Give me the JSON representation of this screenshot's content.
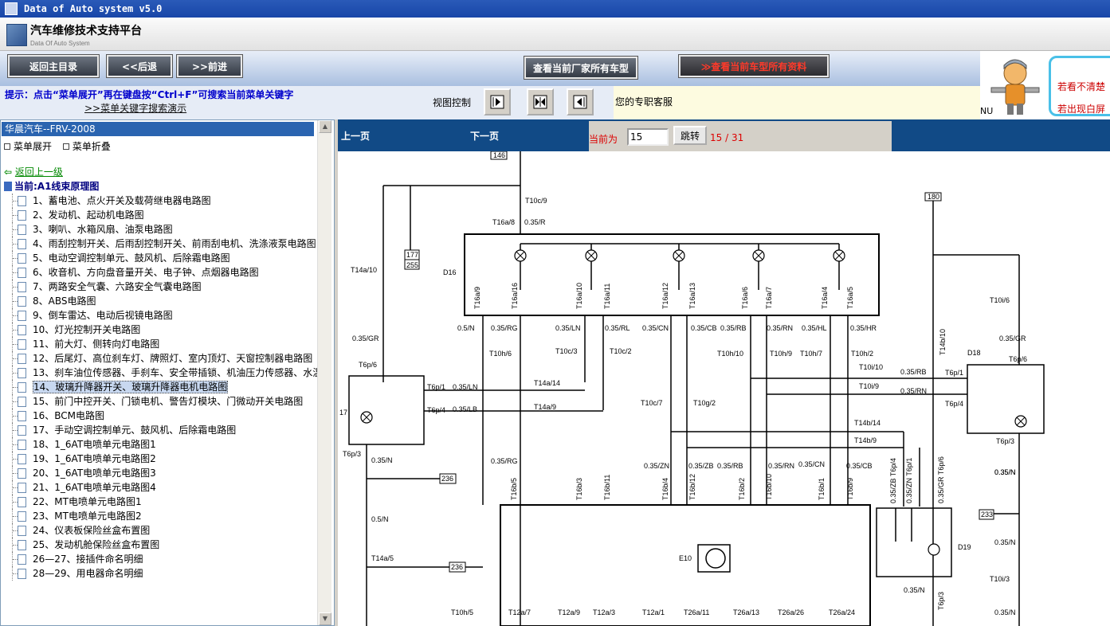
{
  "window": {
    "title": "Data of Auto system v5.0"
  },
  "header": {
    "brand": "汽车维修技术支持平台",
    "brand_sub": "Data Of Auto System"
  },
  "toolbar": {
    "home": "返回主目录",
    "back": "<<后退",
    "forward": ">>前进",
    "all_models": "查看当前厂家所有车型",
    "all_data": "查看当前车型所有资料",
    "all_data_prefix": "≫"
  },
  "hint": {
    "text": "提示：点击“菜单展开”再在键盘按“Ctrl+F”可搜索当前菜单关键字",
    "demo_link": ">>菜单关键字搜索演示",
    "view_control": "视图控制",
    "customer_service": "您的专职客服"
  },
  "banner": {
    "left_text": "NU",
    "line1": "若看不清楚",
    "line2": "若出现白屏"
  },
  "left_panel": {
    "title": "华晨汽车--FRV-2008",
    "expand": "菜单展开",
    "collapse": "菜单折叠",
    "back_link": "返回上一级",
    "current": "当前:A1线束原理图",
    "items": [
      "1、蓄电池、点火开关及载荷继电器电路图",
      "2、发动机、起动机电路图",
      "3、喇叭、水箱风扇、油泵电路图",
      "4、雨刮控制开关、后雨刮控制开关、前雨刮电机、洗涤液泵电路图",
      "5、电动空调控制单元、鼓风机、后除霜电路图",
      "6、收音机、方向盘音量开关、电子钟、点烟器电路图",
      "7、两路安全气囊、六路安全气囊电路图",
      "8、ABS电路图",
      "9、倒车雷达、电动后视镜电路图",
      "10、灯光控制开关电路图",
      "11、前大灯、侧转向灯电路图",
      "12、后尾灯、高位刹车灯、牌照灯、室内顶灯、天窗控制器电路图",
      "13、刹车油位传感器、手刹车、安全带插锁、机油压力传感器、水温",
      "14、玻璃升降器开关、玻璃升降器电机电路图",
      "15、前门中控开关、门锁电机、警告灯模块、门微动开关电路图",
      "16、BCM电路图",
      "17、手动空调控制单元、鼓风机、后除霜电路图",
      "18、1_6AT电喷单元电路图1",
      "19、1_6AT电喷单元电路图2",
      "20、1_6AT电喷单元电路图3",
      "21、1_6AT电喷单元电路图4",
      "22、MT电喷单元电路图1",
      "23、MT电喷单元电路图2",
      "24、仪表板保险丝盒布置图",
      "25、发动机舱保险丝盒布置图",
      "26—27、接插件命名明细",
      "28—29、用电器命名明细"
    ],
    "selected_index": 13
  },
  "pager": {
    "prev": "上一页",
    "next": "下一页",
    "current_label": "当前为",
    "current_page": "15",
    "go": "跳转",
    "total": "15 / 31"
  },
  "diagram": {
    "top_labels": [
      "146",
      "T10c/9",
      "T16a/8",
      "0.35/R",
      "180",
      "177",
      "255",
      "T14a/10",
      "D16"
    ],
    "d16_pins": [
      "T16a/9",
      "T16a/16",
      "T16a/10",
      "T16a/11",
      "T16a/12",
      "T16a/13",
      "T16a/6",
      "T16a/7",
      "T16a/4",
      "T16a/5"
    ],
    "wires_row1": [
      "0.5/N",
      "0.35/RG",
      "0.35/LN",
      "0.35/RL",
      "0.35/CN",
      "0.35/CB",
      "0.35/RB",
      "0.35/RN",
      "0.35/HL",
      "0.35/HR"
    ],
    "conn_row1": [
      "T10h/6",
      "T10c/3",
      "T10c/2",
      "T10h/10",
      "T10h/9",
      "T10h/7",
      "T10h/2"
    ],
    "left_switch": [
      "0.35/GR",
      "T6p/6",
      "T6p/1",
      "0.35/LN",
      "T6p/4",
      "0.35/LB",
      "17",
      "T6p/3",
      "0.35/N"
    ],
    "mid_conn": [
      "T14a/14",
      "T14a/9",
      "T10c/7",
      "T10g/2"
    ],
    "right_labels": [
      "T10i/6",
      "T14b/10",
      "0.35/GR",
      "D18",
      "T6p/6",
      "T10i/10",
      "0.35/RB",
      "T6p/1",
      "T10i/9",
      "0.35/RN",
      "T6p/4",
      "T6p/3",
      "T14b/14",
      "T14b/9",
      "0.35/N"
    ],
    "e10_top": [
      "0.35/RG",
      "0.35/ZN",
      "0.35/ZB",
      "0.35/RB",
      "0.35/RN",
      "0.35/CN",
      "0.35/CB"
    ],
    "e10_pins": [
      "T16b/5",
      "T16b/3",
      "T16b/11",
      "T16b/4",
      "T16b/12",
      "T16b/2",
      "T16b/10",
      "T16b/1",
      "T16b/9"
    ],
    "right_vert": [
      "0.35/ZB T6p/4",
      "0.35/ZN T6p/1",
      "0.35/GR T6p/6"
    ],
    "lower_left": [
      "236",
      "0.5/N",
      "T14a/5",
      "236",
      "T10h/5"
    ],
    "e10_label": "E10",
    "e10_bottom": [
      "T12a/7",
      "T12a/9",
      "T12a/3",
      "T12a/1",
      "T26a/11",
      "T26a/13",
      "T26a/26",
      "T26a/24"
    ],
    "d19": [
      "233",
      "0.35/N",
      "D19",
      "0.35/N",
      "T10i/3",
      "0.35/N",
      "T6p/3",
      "0.35/N"
    ]
  }
}
